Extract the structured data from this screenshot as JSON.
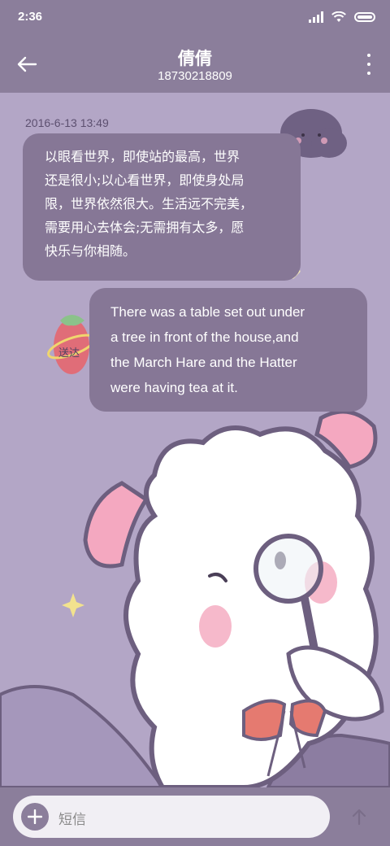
{
  "status_bar": {
    "time": "2:36",
    "icons": [
      "signal-icon",
      "wifi-icon",
      "battery-icon"
    ]
  },
  "header": {
    "title": "倩倩",
    "subtitle": "18730218809",
    "back_icon": "back-arrow-icon",
    "more_icon": "more-vertical-icon"
  },
  "conversation": {
    "timestamp": "2016-6-13 13:49",
    "messages": [
      {
        "direction": "incoming",
        "lines": [
          "以眼看世界，即使站的最高，世界",
          "还是很小;以心看世界，即使身处局",
          "限，世界依然很大。生活远不完美，",
          "需要用心去体会;无需拥有太多，愿",
          "快乐与你相随。"
        ]
      },
      {
        "direction": "outgoing",
        "lines": [
          "There was a table set out under",
          "a tree in front of the house,and",
          "the March Hare and the Hatter",
          "were having tea at it."
        ],
        "status": "送达"
      }
    ]
  },
  "composer": {
    "placeholder": "短信",
    "plus_icon": "plus-icon",
    "send_icon": "send-arrow-icon"
  },
  "colors": {
    "bar": "#8b7e9b",
    "bubble": "#867796",
    "background": "#b3a6c6",
    "input_field": "#f1eff4"
  }
}
